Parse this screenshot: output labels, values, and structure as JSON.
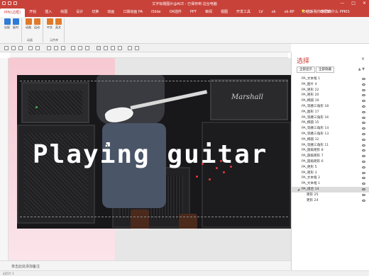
{
  "window": {
    "title": "文字标题图片@ACE - 已保存到 这台电脑",
    "buttons": [
      "—",
      "□",
      "✕"
    ]
  },
  "tabs": [
    "PPK(边框)",
    "开始",
    "插入",
    "绘图",
    "设计",
    "切换",
    "动画",
    "口袋动画 PA",
    "iSlide",
    "OK插件",
    "PPT",
    "审阅",
    "视图",
    "开发工具",
    "LV",
    "ok",
    "ok-8P",
    "OK-Q",
    "OK-3D",
    "PPKIS"
  ],
  "tell_me": "告诉我你想要做什么",
  "ribbon": {
    "buttons": [
      {
        "label": "出现",
        "color": "#2e7bd6"
      },
      {
        "label": "延时",
        "color": "#2e7bd6"
      },
      {
        "label": "动画",
        "color": "#e07a2a"
      },
      {
        "label": "运动",
        "color": "#e07a2a"
      },
      {
        "label": "中文",
        "color": "#e07a2a"
      },
      {
        "label": "英文",
        "color": "#e07a2a"
      }
    ],
    "groups": [
      "动画",
      "元件库"
    ]
  },
  "slide": {
    "title_text": "Playing guitar",
    "amp_brand": "Marshall"
  },
  "notes_placeholder": "单击此处添加备注",
  "status": "幻灯片 1",
  "selection_pane": {
    "title": "选择",
    "show_all": "全部显示",
    "hide_all": "全部隐藏",
    "items": [
      {
        "label": "PA_文本框 1",
        "child": false
      },
      {
        "label": "PA_图片 4",
        "child": false
      },
      {
        "label": "PA_矩形 22",
        "child": false
      },
      {
        "label": "PA_矩形 20",
        "child": false
      },
      {
        "label": "PA_椭圆 19",
        "child": false
      },
      {
        "label": "PA_等腰三角形 18",
        "child": false
      },
      {
        "label": "PA_图形 17",
        "child": false
      },
      {
        "label": "PA_等腰三角形 16",
        "child": false
      },
      {
        "label": "PA_椭圆 15",
        "child": false
      },
      {
        "label": "PA_等腰三角形 14",
        "child": false
      },
      {
        "label": "PA_等腰三角形 13",
        "child": false
      },
      {
        "label": "PA_椭圆 12",
        "child": false
      },
      {
        "label": "PA_等腰三角形 11",
        "child": false
      },
      {
        "label": "PA_圆角矩形 8",
        "child": false
      },
      {
        "label": "PA_圆角矩形 7",
        "child": false
      },
      {
        "label": "PA_圆角矩形 6",
        "child": false
      },
      {
        "label": "PA_矩形 5",
        "child": false
      },
      {
        "label": "PA_矩形 3",
        "child": false
      },
      {
        "label": "PA_文本框 2",
        "child": false
      },
      {
        "label": "PA_文本框 1",
        "child": false
      },
      {
        "label": "PA_组合 14",
        "child": false
      },
      {
        "label": "矩形 25",
        "child": true
      },
      {
        "label": "矩形 24",
        "child": true
      }
    ]
  }
}
